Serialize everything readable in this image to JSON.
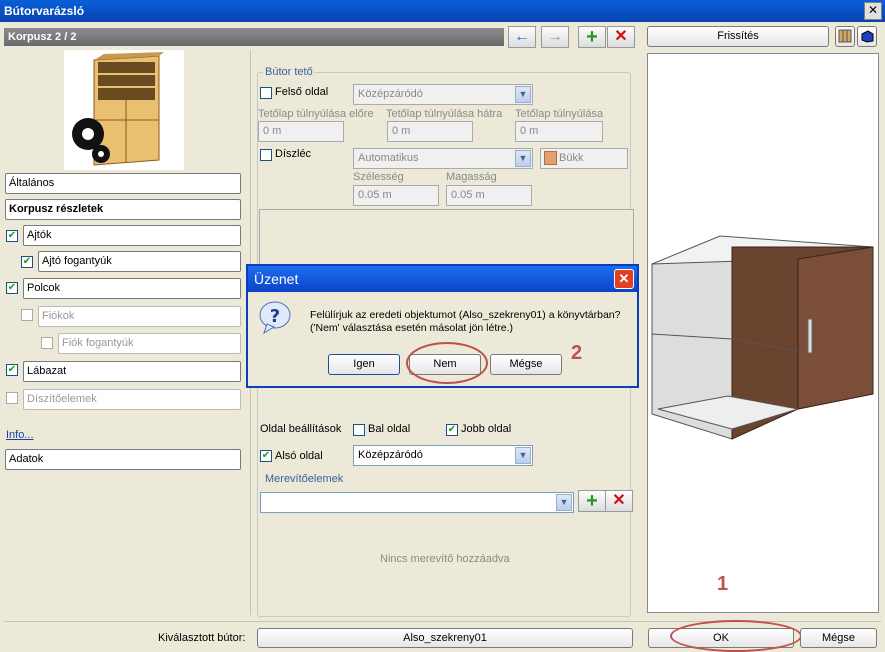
{
  "window": {
    "title": "Bútorvarázsló",
    "close": "✕"
  },
  "header": {
    "title": "Korpusz 2 / 2"
  },
  "toolbar": {
    "back": "←",
    "forward": "→",
    "add": "+",
    "delete": "✕",
    "refresh": "Frissítés"
  },
  "sidebar": {
    "items": [
      {
        "label": "Általános"
      },
      {
        "label": "Korpusz részletek"
      },
      {
        "label": "Ajtók"
      },
      {
        "label": "Ajtó fogantyúk"
      },
      {
        "label": "Polcok"
      },
      {
        "label": "Fiókok"
      },
      {
        "label": "Fiók fogantyúk"
      },
      {
        "label": "Lábazat"
      },
      {
        "label": "Díszítőelemek"
      }
    ],
    "info": "Info...",
    "adatok": "Adatok"
  },
  "top_group": {
    "title": "Bútor tető",
    "felso_oldal": "Felső oldal",
    "felso_value": "Középzáródó",
    "overhang_front": "Tetőlap túlnyúlása előre",
    "overhang_back": "Tetőlap túlnyúlása hátra",
    "overhang_side": "Tetőlap túlnyúlása",
    "v1": "0 m",
    "v2": "0 m",
    "v3": "0 m",
    "diszlec": "Díszléc",
    "diszlec_value": "Automatikus",
    "material": "Bükk",
    "szelesseg": "Szélesség",
    "magassag": "Magasság",
    "szel_value": "0.05 m",
    "mag_value": "0.05 m"
  },
  "side_settings": {
    "label": "Oldal beállítások",
    "bal": "Bal oldal",
    "jobb": "Jobb oldal",
    "also": "Alsó oldal",
    "also_value": "Középzáródó"
  },
  "merevito": {
    "title": "Merevítőelemek",
    "empty": "Nincs merevítő hozzáadva"
  },
  "dialog": {
    "title": "Üzenet",
    "line1": "Felülírjuk az eredeti objektumot (Also_szekreny01) a könyvtárban?",
    "line2": "('Nem' választása esetén másolat jön létre.)",
    "yes": "Igen",
    "no": "Nem",
    "cancel": "Mégse"
  },
  "annotations": {
    "n1": "1",
    "n2": "2"
  },
  "footer": {
    "selected_label": "Kiválasztott bútor:",
    "selected_value": "Also_szekreny01",
    "ok": "OK",
    "cancel": "Mégse"
  }
}
